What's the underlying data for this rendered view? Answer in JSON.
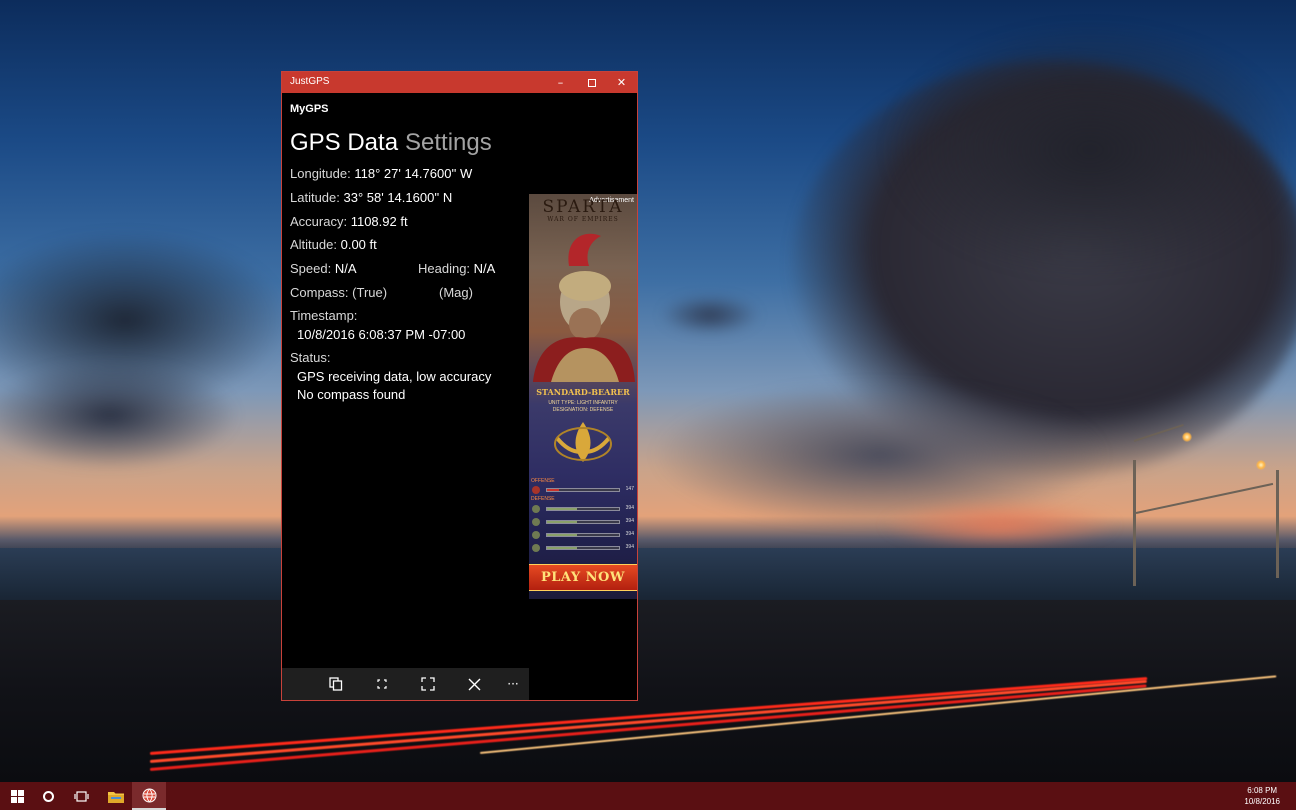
{
  "window": {
    "title": "JustGPS",
    "app_name": "MyGPS",
    "tabs": {
      "active": "GPS Data",
      "inactive": "Settings"
    }
  },
  "gps": {
    "longitude": {
      "label": "Longitude:",
      "value": "118° 27' 14.7600'' W"
    },
    "latitude": {
      "label": "Latitude:",
      "value": "33° 58' 14.1600'' N"
    },
    "accuracy": {
      "label": "Accuracy:",
      "value": "1108.92 ft"
    },
    "altitude": {
      "label": "Altitude:",
      "value": "0.00 ft"
    },
    "speed": {
      "label": "Speed:",
      "value": "N/A"
    },
    "heading": {
      "label": "Heading:",
      "value": "N/A"
    },
    "compass": {
      "label": "Compass:",
      "true_label": "(True)",
      "mag_label": "(Mag)"
    },
    "timestamp": {
      "label": "Timestamp:",
      "value": "10/8/2016 6:08:37 PM -07:00"
    },
    "status": {
      "label": "Status:",
      "lines": [
        "GPS receiving data, low accuracy",
        "No compass found"
      ]
    }
  },
  "ad": {
    "label": "Advertisement",
    "brand": "SPARTA",
    "subtitle": "WAR OF EMPIRES",
    "unit_name": "STANDARD-BEARER",
    "unit_type": "UNIT TYPE: LIGHT INFANTRY",
    "designation": "DESIGNATION: DEFENSE",
    "offense_label": "OFFENSE",
    "defense_label": "DEFENSE",
    "offense_value": "147",
    "defense_values": [
      "394",
      "394",
      "394",
      "394"
    ],
    "cta": "PLAY NOW"
  },
  "appbar": {
    "icons": [
      "copy-icon",
      "compact-overlay-icon",
      "full-screen-icon",
      "close-icon",
      "more-icon"
    ],
    "more_glyph": "···"
  },
  "taskbar": {
    "time": "6:08 PM",
    "date": "10/8/2016",
    "accent": "#5a0f12"
  },
  "colors": {
    "titlebar": "#c8392e",
    "window_bg": "#000000",
    "inactive_tab": "#a3a3a3"
  }
}
